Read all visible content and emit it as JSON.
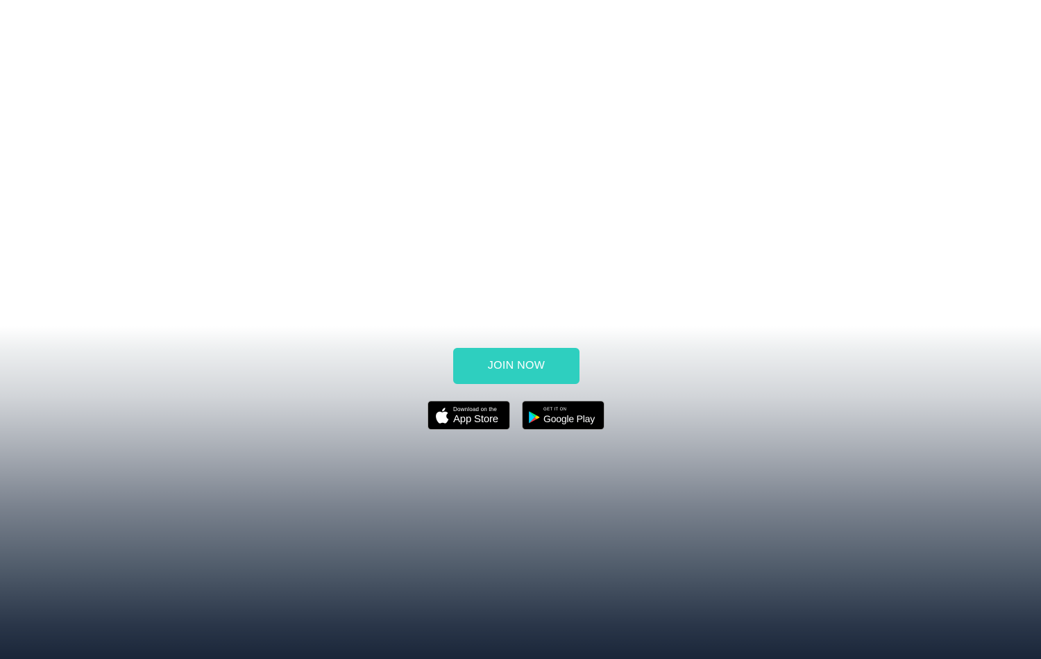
{
  "cta": {
    "join_label": "JOIN NOW",
    "color": "#2ecfbf"
  },
  "badges": {
    "app_store": {
      "small_text": "Download on the",
      "large_text": "App Store",
      "icon": "apple-icon"
    },
    "google_play": {
      "small_text": "GET IT ON",
      "large_text": "Google Play",
      "icon": "google-play-icon"
    }
  },
  "colors": {
    "gradient_top": "#ffffff",
    "gradient_bottom": "#1a2639",
    "badge_background": "#000000"
  }
}
